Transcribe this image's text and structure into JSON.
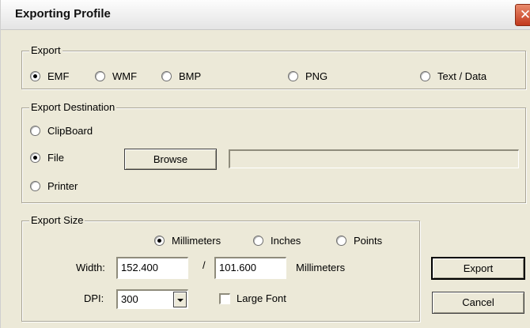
{
  "window": {
    "title": "Exporting Profile",
    "close_glyph": "✕"
  },
  "export": {
    "legend": "Export",
    "options": [
      {
        "label": "EMF",
        "checked": true
      },
      {
        "label": "WMF",
        "checked": false
      },
      {
        "label": "BMP",
        "checked": false
      },
      {
        "label": "PNG",
        "checked": false
      },
      {
        "label": "Text / Data",
        "checked": false
      }
    ]
  },
  "destination": {
    "legend": "Export Destination",
    "options": [
      {
        "label": "ClipBoard",
        "checked": false
      },
      {
        "label": "File",
        "checked": true
      },
      {
        "label": "Printer",
        "checked": false
      }
    ],
    "browse_label": "Browse",
    "file_path": ""
  },
  "size": {
    "legend": "Export Size",
    "units": [
      {
        "label": "Millimeters",
        "checked": true
      },
      {
        "label": "Inches",
        "checked": false
      },
      {
        "label": "Points",
        "checked": false
      }
    ],
    "width_label": "Width:",
    "width_value": "152.400",
    "separator": "/",
    "height_value": "101.600",
    "unit_label": "Millimeters",
    "dpi_label": "DPI:",
    "dpi_value": "300",
    "large_font_label": "Large Font",
    "large_font_checked": false
  },
  "actions": {
    "export_label": "Export",
    "cancel_label": "Cancel"
  },
  "colors": {
    "dialog_bg": "#ece9d8",
    "close_red": "#c2391d"
  }
}
